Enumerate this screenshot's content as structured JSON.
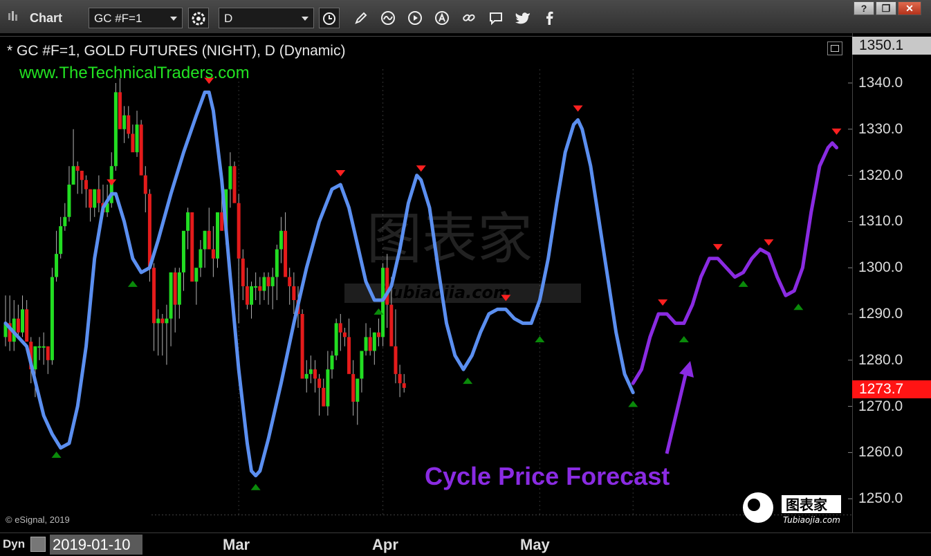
{
  "window": {
    "title": "Chart"
  },
  "toolbar": {
    "symbol": "GC #F=1",
    "interval": "D"
  },
  "window_buttons": {
    "help": "?",
    "restore": "❐",
    "close": "✕"
  },
  "chart_header": {
    "line1": "* GC #F=1, GOLD FUTURES (NIGHT), D (Dynamic)",
    "line2": "www.TheTechnicalTraders.com"
  },
  "copyright": "© eSignal, 2019",
  "forecast_annotation": "Cycle Price Forecast",
  "watermark": {
    "text": "图表家",
    "url": "Tubiaojia.com"
  },
  "bottom_bar": {
    "mode": "Dyn",
    "start_date": "2019-01-10",
    "month_labels": [
      "Mar",
      "Apr",
      "May"
    ]
  },
  "price_labels": {
    "top": "1350.1",
    "last": "1273.7"
  },
  "colors": {
    "up_candle": "#22dd22",
    "down_candle": "#e41b1b",
    "cycle_line": "#5b8ff0",
    "forecast_line": "#8a2be2",
    "peak_marker": "#ff2020",
    "trough_marker": "#0a8a0a",
    "last_price_tag": "#ff1414"
  },
  "chart_data": {
    "type": "line",
    "title": "* GC #F=1, GOLD FUTURES (NIGHT), D (Dynamic)",
    "y_ticks": [
      "1340.0",
      "1330.0",
      "1320.0",
      "1310.0",
      "1300.0",
      "1290.0",
      "1280.0",
      "1270.0",
      "1260.0",
      "1250.0"
    ],
    "ylim": [
      1244,
      1353
    ],
    "x_tick_labels": [
      "Mar",
      "Apr",
      "May"
    ],
    "series": [
      {
        "points": [
          [
            0,
            1288
          ],
          [
            5,
            1283
          ],
          [
            9,
            1268
          ],
          [
            11,
            1264
          ],
          [
            13,
            1261
          ],
          [
            15,
            1262
          ],
          [
            17,
            1270
          ],
          [
            19,
            1283
          ],
          [
            21,
            1302
          ],
          [
            23,
            1313
          ],
          [
            25,
            1316
          ],
          [
            26,
            1316
          ],
          [
            28,
            1310
          ],
          [
            30,
            1302
          ],
          [
            32,
            1299
          ],
          [
            34,
            1300
          ],
          [
            36,
            1306
          ],
          [
            39,
            1316
          ],
          [
            42,
            1325
          ],
          [
            45,
            1333
          ],
          [
            47,
            1338
          ],
          [
            48,
            1338
          ],
          [
            49,
            1334
          ],
          [
            51,
            1319
          ],
          [
            53,
            1298
          ],
          [
            55,
            1278
          ],
          [
            57,
            1262
          ],
          [
            58,
            1256
          ],
          [
            59,
            1255
          ],
          [
            60,
            1256
          ],
          [
            62,
            1263
          ],
          [
            65,
            1275
          ],
          [
            68,
            1288
          ],
          [
            71,
            1300
          ],
          [
            74,
            1310
          ],
          [
            77,
            1317
          ],
          [
            79,
            1318
          ],
          [
            81,
            1313
          ],
          [
            83,
            1305
          ],
          [
            85,
            1297
          ],
          [
            87,
            1293
          ],
          [
            89,
            1293
          ],
          [
            91,
            1296
          ],
          [
            93,
            1304
          ],
          [
            95,
            1314
          ],
          [
            97,
            1320
          ],
          [
            98,
            1319
          ],
          [
            100,
            1313
          ],
          [
            102,
            1300
          ],
          [
            104,
            1288
          ],
          [
            106,
            1281
          ],
          [
            108,
            1278
          ],
          [
            110,
            1281
          ],
          [
            112,
            1286
          ],
          [
            114,
            1290
          ],
          [
            116,
            1291
          ],
          [
            118,
            1291
          ],
          [
            120,
            1289
          ],
          [
            122,
            1288
          ],
          [
            124,
            1288
          ],
          [
            126,
            1293
          ],
          [
            128,
            1302
          ],
          [
            130,
            1314
          ],
          [
            132,
            1325
          ],
          [
            134,
            1331
          ],
          [
            135,
            1332
          ],
          [
            136,
            1330
          ],
          [
            138,
            1322
          ],
          [
            140,
            1310
          ],
          [
            142,
            1298
          ],
          [
            144,
            1286
          ],
          [
            146,
            1277
          ],
          [
            148,
            1273
          ]
        ]
      },
      {
        "points": [
          [
            148,
            1275
          ],
          [
            150,
            1278
          ],
          [
            152,
            1285
          ],
          [
            154,
            1290
          ],
          [
            156,
            1290
          ],
          [
            158,
            1288
          ],
          [
            160,
            1288
          ],
          [
            162,
            1292
          ],
          [
            164,
            1298
          ],
          [
            166,
            1302
          ],
          [
            168,
            1302
          ],
          [
            170,
            1300
          ],
          [
            172,
            1298
          ],
          [
            174,
            1299
          ],
          [
            176,
            1302
          ],
          [
            178,
            1304
          ],
          [
            180,
            1303
          ],
          [
            182,
            1298
          ],
          [
            184,
            1294
          ],
          [
            186,
            1295
          ],
          [
            188,
            1300
          ],
          [
            190,
            1312
          ],
          [
            192,
            1322
          ],
          [
            194,
            1326
          ],
          [
            195,
            1327
          ],
          [
            196,
            1326
          ]
        ]
      }
    ],
    "peaks": [
      [
        25,
        1316
      ],
      [
        48,
        1338
      ],
      [
        79,
        1318
      ],
      [
        98,
        1319
      ],
      [
        118,
        1291
      ],
      [
        135,
        1332
      ],
      [
        155,
        1290
      ],
      [
        168,
        1302
      ],
      [
        180,
        1303
      ],
      [
        196,
        1327
      ]
    ],
    "troughs": [
      [
        12,
        1262
      ],
      [
        30,
        1299
      ],
      [
        59,
        1255
      ],
      [
        88,
        1293
      ],
      [
        109,
        1278
      ],
      [
        126,
        1287
      ],
      [
        148,
        1273
      ],
      [
        160,
        1287
      ],
      [
        174,
        1299
      ],
      [
        187,
        1294
      ]
    ],
    "candles": [
      [
        1285,
        1294,
        1283,
        1288
      ],
      [
        1288,
        1294,
        1282,
        1284
      ],
      [
        1284,
        1293,
        1282,
        1289
      ],
      [
        1289,
        1292,
        1285,
        1286
      ],
      [
        1286,
        1294,
        1285,
        1291
      ],
      [
        1291,
        1293,
        1287,
        1284
      ],
      [
        1284,
        1285,
        1275,
        1278
      ],
      [
        1278,
        1283,
        1272,
        1283
      ],
      [
        1283,
        1285,
        1280,
        1283
      ],
      [
        1283,
        1286,
        1279,
        1283
      ],
      [
        1283,
        1282,
        1277,
        1280
      ],
      [
        1280,
        1300,
        1279,
        1298
      ],
      [
        1298,
        1308,
        1297,
        1303
      ],
      [
        1303,
        1311,
        1302,
        1309
      ],
      [
        1309,
        1314,
        1308,
        1311
      ],
      [
        1311,
        1322,
        1310,
        1318
      ],
      [
        1318,
        1330,
        1318,
        1322
      ],
      [
        1322,
        1323,
        1316,
        1321
      ],
      [
        1321,
        1321,
        1316,
        1319
      ],
      [
        1319,
        1320,
        1313,
        1317
      ],
      [
        1317,
        1317,
        1310,
        1313
      ],
      [
        1313,
        1317,
        1311,
        1317
      ],
      [
        1317,
        1320,
        1312,
        1314
      ],
      [
        1314,
        1318,
        1313,
        1312
      ],
      [
        1312,
        1318,
        1311,
        1314
      ],
      [
        1314,
        1325,
        1313,
        1322
      ],
      [
        1322,
        1340,
        1321,
        1338
      ],
      [
        1338,
        1341,
        1333,
        1330
      ],
      [
        1330,
        1335,
        1327,
        1333
      ],
      [
        1333,
        1335,
        1328,
        1329
      ],
      [
        1329,
        1331,
        1326,
        1325
      ],
      [
        1325,
        1334,
        1324,
        1331
      ],
      [
        1331,
        1332,
        1320,
        1320
      ],
      [
        1320,
        1322,
        1312,
        1316
      ],
      [
        1316,
        1317,
        1297,
        1300
      ],
      [
        1300,
        1301,
        1282,
        1288
      ],
      [
        1288,
        1291,
        1281,
        1289
      ],
      [
        1289,
        1290,
        1281,
        1288
      ],
      [
        1288,
        1292,
        1279,
        1289
      ],
      [
        1289,
        1295,
        1283,
        1299
      ],
      [
        1299,
        1300,
        1286,
        1292
      ],
      [
        1292,
        1300,
        1289,
        1299
      ],
      [
        1299,
        1304,
        1295,
        1308
      ],
      [
        1308,
        1313,
        1304,
        1312
      ],
      [
        1312,
        1312,
        1300,
        1297
      ],
      [
        1297,
        1299,
        1292,
        1300
      ],
      [
        1300,
        1306,
        1298,
        1304
      ],
      [
        1304,
        1308,
        1300,
        1308
      ],
      [
        1308,
        1313,
        1305,
        1304
      ],
      [
        1304,
        1309,
        1298,
        1302
      ],
      [
        1302,
        1310,
        1300,
        1312
      ],
      [
        1312,
        1318,
        1308,
        1308
      ],
      [
        1308,
        1313,
        1305,
        1317
      ],
      [
        1317,
        1325,
        1313,
        1322
      ],
      [
        1322,
        1323,
        1315,
        1314
      ],
      [
        1314,
        1316,
        1288,
        1302
      ],
      [
        1302,
        1304,
        1293,
        1296
      ],
      [
        1296,
        1300,
        1291,
        1292
      ],
      [
        1292,
        1297,
        1289,
        1296
      ],
      [
        1296,
        1299,
        1293,
        1296
      ],
      [
        1296,
        1298,
        1292,
        1295
      ],
      [
        1295,
        1299,
        1293,
        1298
      ],
      [
        1298,
        1299,
        1292,
        1296
      ],
      [
        1296,
        1300,
        1291,
        1298
      ],
      [
        1298,
        1305,
        1293,
        1304
      ],
      [
        1304,
        1311,
        1301,
        1308
      ],
      [
        1308,
        1312,
        1303,
        1298
      ],
      [
        1298,
        1300,
        1292,
        1296
      ],
      [
        1296,
        1299,
        1290,
        1293
      ],
      [
        1293,
        1296,
        1287,
        1290
      ],
      [
        1290,
        1291,
        1276,
        1276
      ],
      [
        1276,
        1280,
        1273,
        1277
      ],
      [
        1277,
        1281,
        1275,
        1278
      ],
      [
        1278,
        1280,
        1273,
        1276
      ],
      [
        1276,
        1277,
        1268,
        1274
      ],
      [
        1274,
        1276,
        1270,
        1270
      ],
      [
        1270,
        1282,
        1268,
        1278
      ],
      [
        1278,
        1282,
        1276,
        1281
      ],
      [
        1281,
        1289,
        1280,
        1288
      ],
      [
        1288,
        1290,
        1282,
        1286
      ],
      [
        1286,
        1287,
        1283,
        1285
      ],
      [
        1285,
        1289,
        1283,
        1277
      ],
      [
        1277,
        1280,
        1268,
        1271
      ],
      [
        1271,
        1276,
        1266,
        1276
      ],
      [
        1276,
        1280,
        1273,
        1282
      ],
      [
        1282,
        1288,
        1281,
        1285
      ],
      [
        1285,
        1287,
        1281,
        1282
      ],
      [
        1282,
        1286,
        1279,
        1286
      ],
      [
        1286,
        1289,
        1283,
        1285
      ],
      [
        1285,
        1301,
        1283,
        1300
      ],
      [
        1300,
        1303,
        1287,
        1292
      ],
      [
        1292,
        1298,
        1284,
        1283
      ],
      [
        1283,
        1291,
        1275,
        1277
      ],
      [
        1277,
        1279,
        1272,
        1275
      ],
      [
        1275,
        1277,
        1273,
        1274
      ]
    ]
  }
}
